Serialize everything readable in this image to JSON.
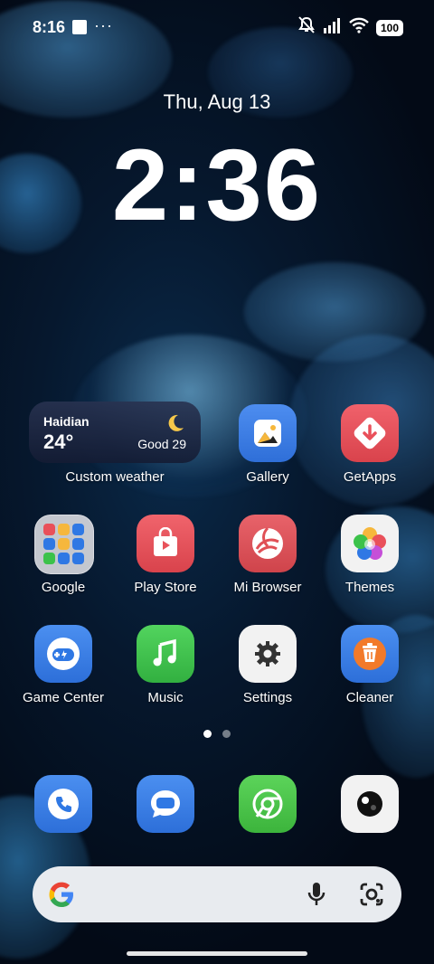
{
  "status_bar": {
    "time": "8:16",
    "more": "···",
    "battery": "100",
    "icons": [
      "notification-square-icon",
      "mute-bell-icon",
      "signal-icon",
      "wifi-icon",
      "battery-icon"
    ]
  },
  "lockscreen": {
    "date": "Thu, Aug 13",
    "clock": "2:36"
  },
  "weather_widget": {
    "city": "Haidian",
    "temperature": "24°",
    "condition_icon": "moon-icon",
    "air_quality": "Good 29",
    "label": "Custom weather"
  },
  "apps": {
    "gallery": "Gallery",
    "getapps": "GetApps",
    "google": "Google",
    "play_store": "Play Store",
    "mi_browser": "Mi Browser",
    "themes": "Themes",
    "game_center": "Game Center",
    "music": "Music",
    "settings": "Settings",
    "cleaner": "Cleaner"
  },
  "page_indicator": {
    "pages": 2,
    "current_page": 1
  },
  "dock": [
    "phone-icon",
    "messages-icon",
    "chrome-icon",
    "camera-icon"
  ],
  "colors": {
    "gallery_bg": "#3a7be0",
    "getapps_bg": "#e9505a",
    "play_store_bg": "#e8525a",
    "mi_browser_bg": "#e05056",
    "game_center_bg": "#2f78e4",
    "music_bg": "#3cc24a",
    "settings_bg": "#f2f2f2",
    "cleaner_bg": "#2f78e4",
    "phone_bg": "#2f78e4",
    "messages_bg": "#2f78e4",
    "chrome_bg": "#4cc24c",
    "camera_bg": "#f2f2f2"
  },
  "search_bar": {
    "placeholder": "",
    "icons": [
      "google-g-icon",
      "microphone-icon",
      "google-lens-icon"
    ]
  }
}
